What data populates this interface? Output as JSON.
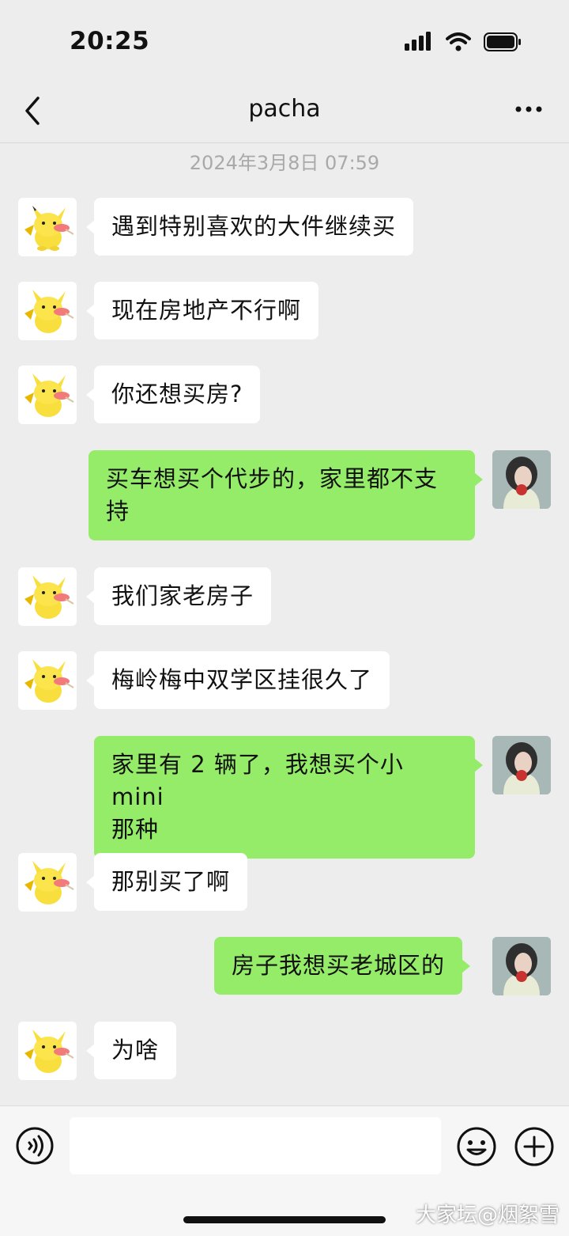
{
  "status_bar": {
    "time": "20:25",
    "icons": [
      "signal-icon",
      "wifi-icon",
      "battery-icon"
    ]
  },
  "nav": {
    "title": "pacha",
    "back_icon": "chevron-left-icon",
    "more_icon": "more-dots-icon"
  },
  "chat": {
    "timestamp": "2024年3月8日 07:59",
    "messages": [
      {
        "side": "left",
        "text": "遇到特别喜欢的大件继续买"
      },
      {
        "side": "left",
        "text": "现在房地产不行啊"
      },
      {
        "side": "left",
        "text": "你还想买房?"
      },
      {
        "side": "right",
        "line1": "买车想买个代步的，家里都不支",
        "line2": "持"
      },
      {
        "side": "left",
        "text": "我们家老房子"
      },
      {
        "side": "left",
        "text": "梅岭梅中双学区挂很久了"
      },
      {
        "side": "right",
        "line1": "家里有 2 辆了，我想买个小 mini",
        "line2": "那种"
      },
      {
        "side": "left",
        "text": "那别买了啊"
      },
      {
        "side": "right",
        "text": "房子我想买老城区的"
      },
      {
        "side": "left",
        "text": "为啥"
      }
    ]
  },
  "input_bar": {
    "value": "",
    "icons": [
      "voice-icon",
      "emoji-icon",
      "plus-icon"
    ]
  },
  "watermark": "大家坛@烟絮雪",
  "colors": {
    "background": "#ededed",
    "bubble_self": "#95ec69",
    "bubble_other": "#ffffff"
  }
}
